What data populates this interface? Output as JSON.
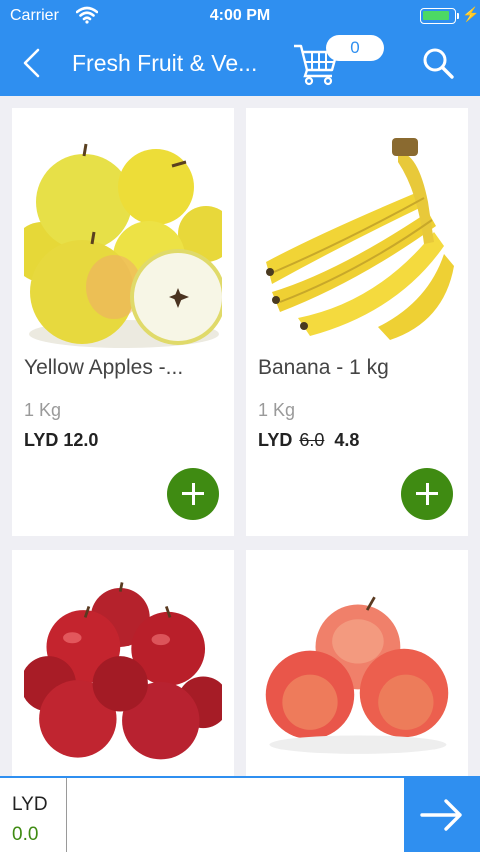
{
  "status_bar": {
    "carrier": "Carrier",
    "time": "4:00 PM"
  },
  "header": {
    "title": "Fresh Fruit  & Ve...",
    "cart_count": "0"
  },
  "products": [
    {
      "name": "Yellow Apples  -...",
      "unit": "1 Kg",
      "currency": "LYD",
      "price": "12.0",
      "image": "yellow-apples-image"
    },
    {
      "name": "Banana - 1 kg",
      "unit": "1 Kg",
      "currency": "LYD",
      "old_price": "6.0",
      "price": "4.8",
      "image": "banana-image"
    },
    {
      "image": "red-apples-image"
    },
    {
      "image": "gala-apples-image"
    }
  ],
  "bottom_bar": {
    "currency": "LYD",
    "total": "0.0"
  },
  "colors": {
    "primary": "#2f8ff0",
    "add_button": "#3f8b12",
    "total_text": "#3f8b12"
  }
}
